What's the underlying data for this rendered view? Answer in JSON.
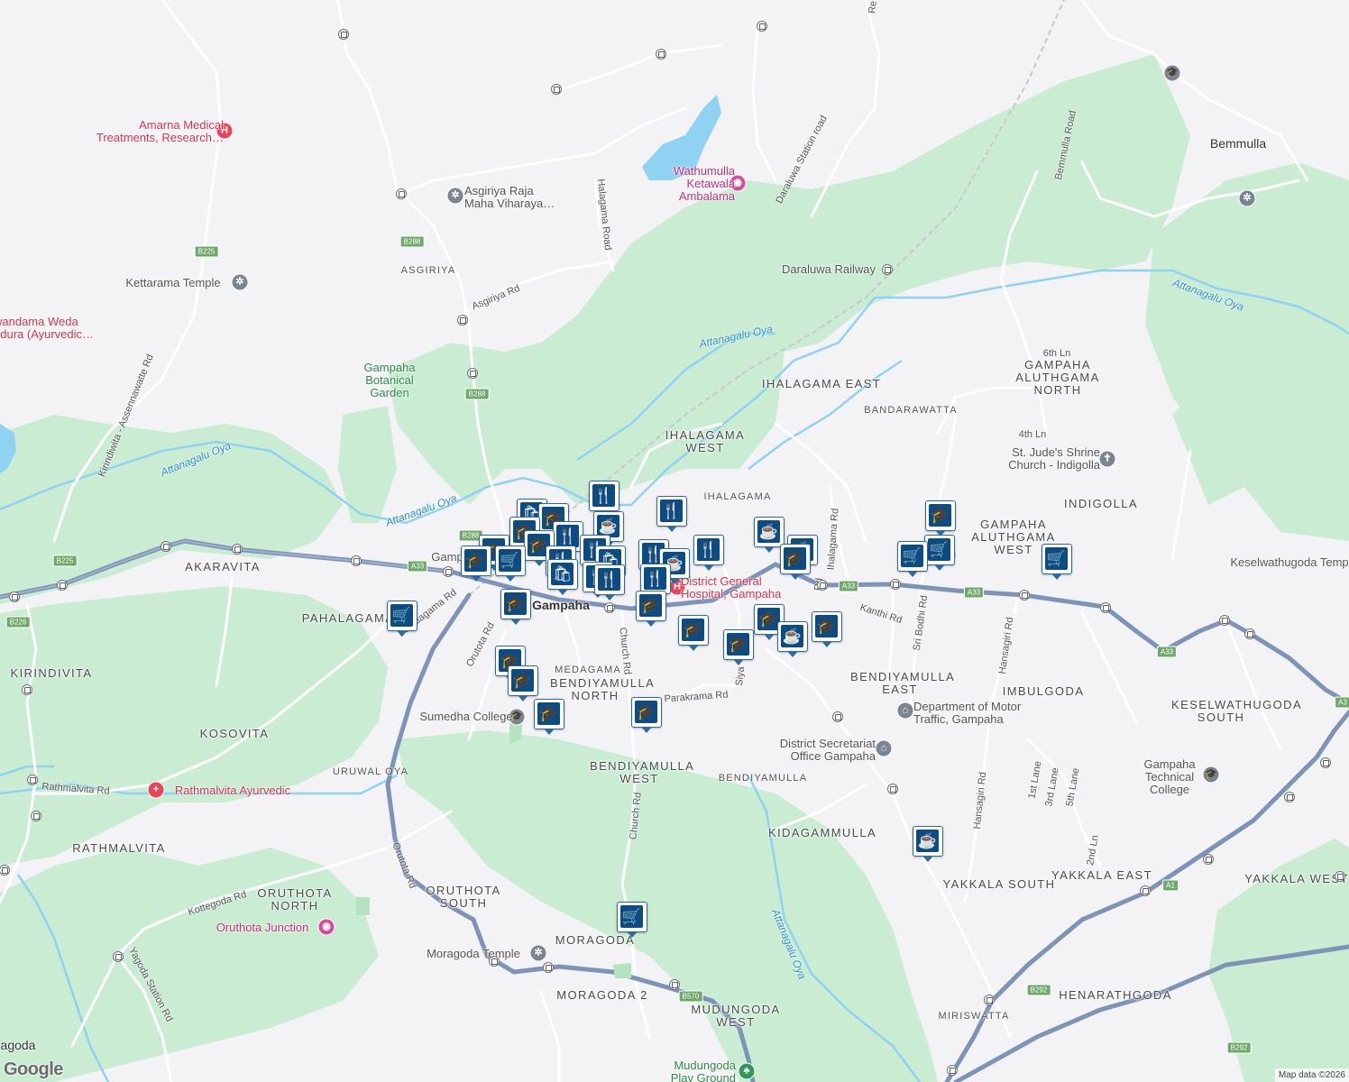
{
  "colors": {
    "background": "#f3f2f4",
    "park": "#c9ecd2",
    "water": "#8fd2f2",
    "highway": "#7d94b7",
    "road": "#ffffff",
    "marker": "#0d4c83",
    "poi_red": "#d6344a",
    "poi_pink": "#c0307a"
  },
  "areas": [
    {
      "name": "IHALAGAMA EAST"
    },
    {
      "name": "IHALAGAMA WEST"
    },
    {
      "name": "IHALAGAMA"
    },
    {
      "name": "BANDARAWATTA"
    },
    {
      "name": "GAMPAHA ALUTHGAMA NORTH"
    },
    {
      "name": "GAMPAHA ALUTHGAMA WEST"
    },
    {
      "name": "INDIGOLLA"
    },
    {
      "name": "AKARAVITA"
    },
    {
      "name": "PAHALAGAMA"
    },
    {
      "name": "KIRINDIVITA"
    },
    {
      "name": "KOSOVITA"
    },
    {
      "name": "RATHMALVITA"
    },
    {
      "name": "ORUTHOTA NORTH"
    },
    {
      "name": "ORUTHOTA SOUTH"
    },
    {
      "name": "MORAGODA"
    },
    {
      "name": "MORAGODA 2"
    },
    {
      "name": "MEDAGAMA"
    },
    {
      "name": "BENDIYAMULLA NORTH"
    },
    {
      "name": "BENDIYAMULLA WEST"
    },
    {
      "name": "BENDIYAMULLA"
    },
    {
      "name": "BENDIYAMULLA EAST"
    },
    {
      "name": "IMBULGODA"
    },
    {
      "name": "KESELWATHUGODA SOUTH"
    },
    {
      "name": "KIDAGAMMULLA"
    },
    {
      "name": "YAKKALA SOUTH"
    },
    {
      "name": "YAKKALA EAST"
    },
    {
      "name": "YAKKALA WEST"
    },
    {
      "name": "HENARATHGODA"
    },
    {
      "name": "MUDUNGODA WEST"
    },
    {
      "name": "MIRISWATTA"
    },
    {
      "name": "ASGIRIYA"
    },
    {
      "name": "Bemmulla"
    },
    {
      "name": "Gampaha"
    },
    {
      "name": "Yagoda"
    },
    {
      "name": "agoda"
    },
    {
      "name": "Keselwathugoda Temp"
    }
  ],
  "roads": [
    {
      "name": "Asgiriya Rd"
    },
    {
      "name": "Halagama Road"
    },
    {
      "name": "Daraluwa Station road"
    },
    {
      "name": "Bemmulla Road"
    },
    {
      "name": "Kirindiwita - Assennawatte Rd"
    },
    {
      "name": "Pahalagama Rd"
    },
    {
      "name": "Orutota Rd"
    },
    {
      "name": "Church Rd"
    },
    {
      "name": "Parakrama Rd"
    },
    {
      "name": "Kanthi Rd"
    },
    {
      "name": "Sri Bodhi Rd"
    },
    {
      "name": "Hansagiri Rd"
    },
    {
      "name": "Rathmalvita Rd"
    },
    {
      "name": "Kottegoda Rd"
    },
    {
      "name": "Yagoda Station Rd"
    },
    {
      "name": "Ihalagama Rd"
    },
    {
      "name": "6th Ln"
    },
    {
      "name": "4th Ln"
    },
    {
      "name": "1st Lane"
    },
    {
      "name": "3rd Lane"
    },
    {
      "name": "5th Lane"
    },
    {
      "name": "2nd Ln"
    },
    {
      "name": "Rd"
    },
    {
      "name": "Siya"
    },
    {
      "name": "Pa"
    },
    {
      "name": "Re"
    }
  ],
  "waterways": [
    {
      "name": "Attanagalu Oya"
    },
    {
      "name": "URUWAL OYA"
    }
  ],
  "route_shields": [
    "B225",
    "B288",
    "B226",
    "A33",
    "B570",
    "B292",
    "A1",
    "A3"
  ],
  "pois": {
    "amarna": "Amarna Medical Treatments, Research…",
    "asgiriya_raja": "Asgiriya Raja Maha Viharaya…",
    "wathumulla": "Wathumulla Ketawala Ambalama",
    "kettarama": "Kettarama Temple",
    "wandama": "wandama Weda adura (Ayurvedic…",
    "botanical": "Gampaha Botanical Garden",
    "daraluwa": "Daraluwa Railway",
    "st_judes": "St. Jude's Shrine Church - Indigolla",
    "district_hospital": "District General Hospital, Gampaha",
    "sumedha": "Sumedha College",
    "rathmalvita_ayurvedic": "Rathmalvita Ayurvedic",
    "motor_traffic": "Department of Motor Traffic, Gampaha",
    "district_secretariat": "District Secretariat Office Gampaha",
    "technical_college": "Gampaha Technical College",
    "oruthota_junction": "Oruthota Junction",
    "moragoda_temple": "Moragoda Temple",
    "mudungoda_play": "Mudungoda Play Ground",
    "gampaha_station": "Gamp"
  },
  "markers": [
    {
      "type": "restaurant",
      "icon": "🍴"
    },
    {
      "type": "cafe",
      "icon": "☕"
    },
    {
      "type": "school",
      "icon": "🎓"
    },
    {
      "type": "grocery",
      "icon": "🛒"
    },
    {
      "type": "shopping",
      "icon": "🛍"
    }
  ],
  "attribution": "Map data ©2026",
  "google_logo": "Google"
}
